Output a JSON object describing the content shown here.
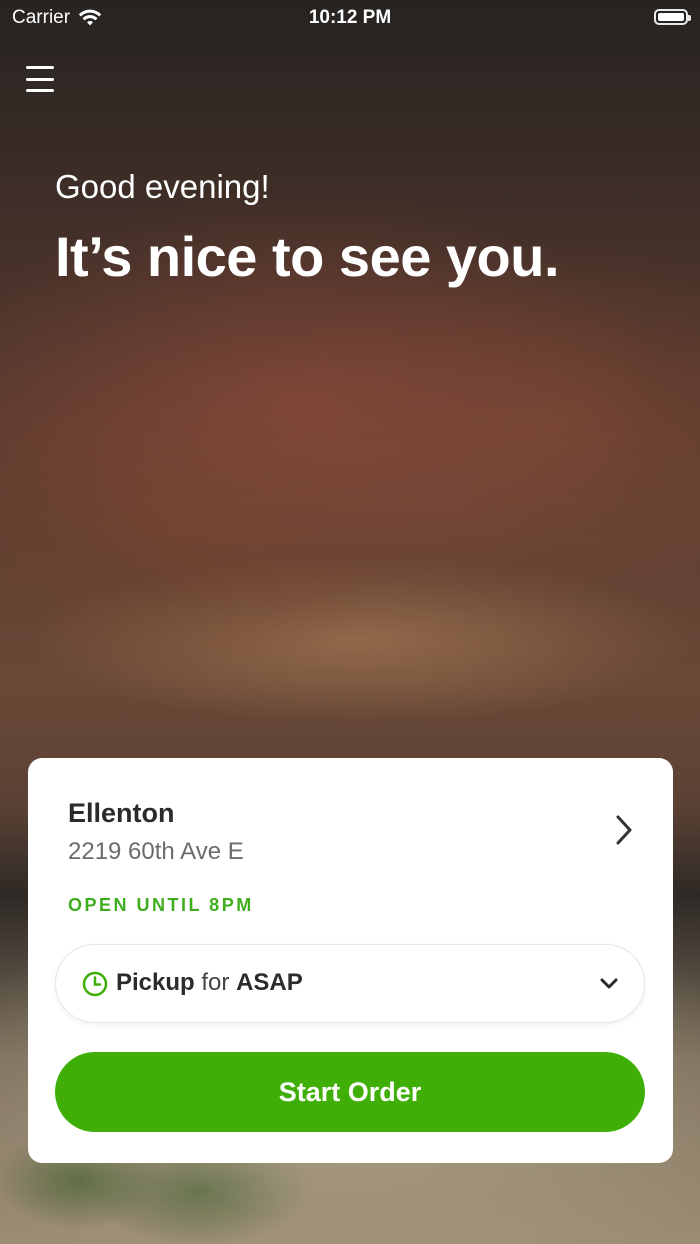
{
  "status_bar": {
    "carrier": "Carrier",
    "time": "10:12 PM"
  },
  "greeting": {
    "subtitle": "Good evening!",
    "headline": "It’s nice to see you."
  },
  "store": {
    "name": "Ellenton",
    "address": "2219 60th Ave E",
    "hours": "OPEN UNTIL 8PM"
  },
  "pickup": {
    "mode": "Pickup",
    "connector": "for",
    "time": "ASAP"
  },
  "actions": {
    "start_order_label": "Start Order"
  },
  "colors": {
    "accent_green": "#3fae07",
    "hours_green": "#3fae1e",
    "card_background": "#ffffff"
  },
  "icons": {
    "menu": "hamburger-menu-icon",
    "store_chevron": "chevron-right-icon",
    "clock": "clock-icon",
    "dropdown": "chevron-down-icon",
    "wifi": "wifi-icon",
    "battery": "battery-icon"
  }
}
